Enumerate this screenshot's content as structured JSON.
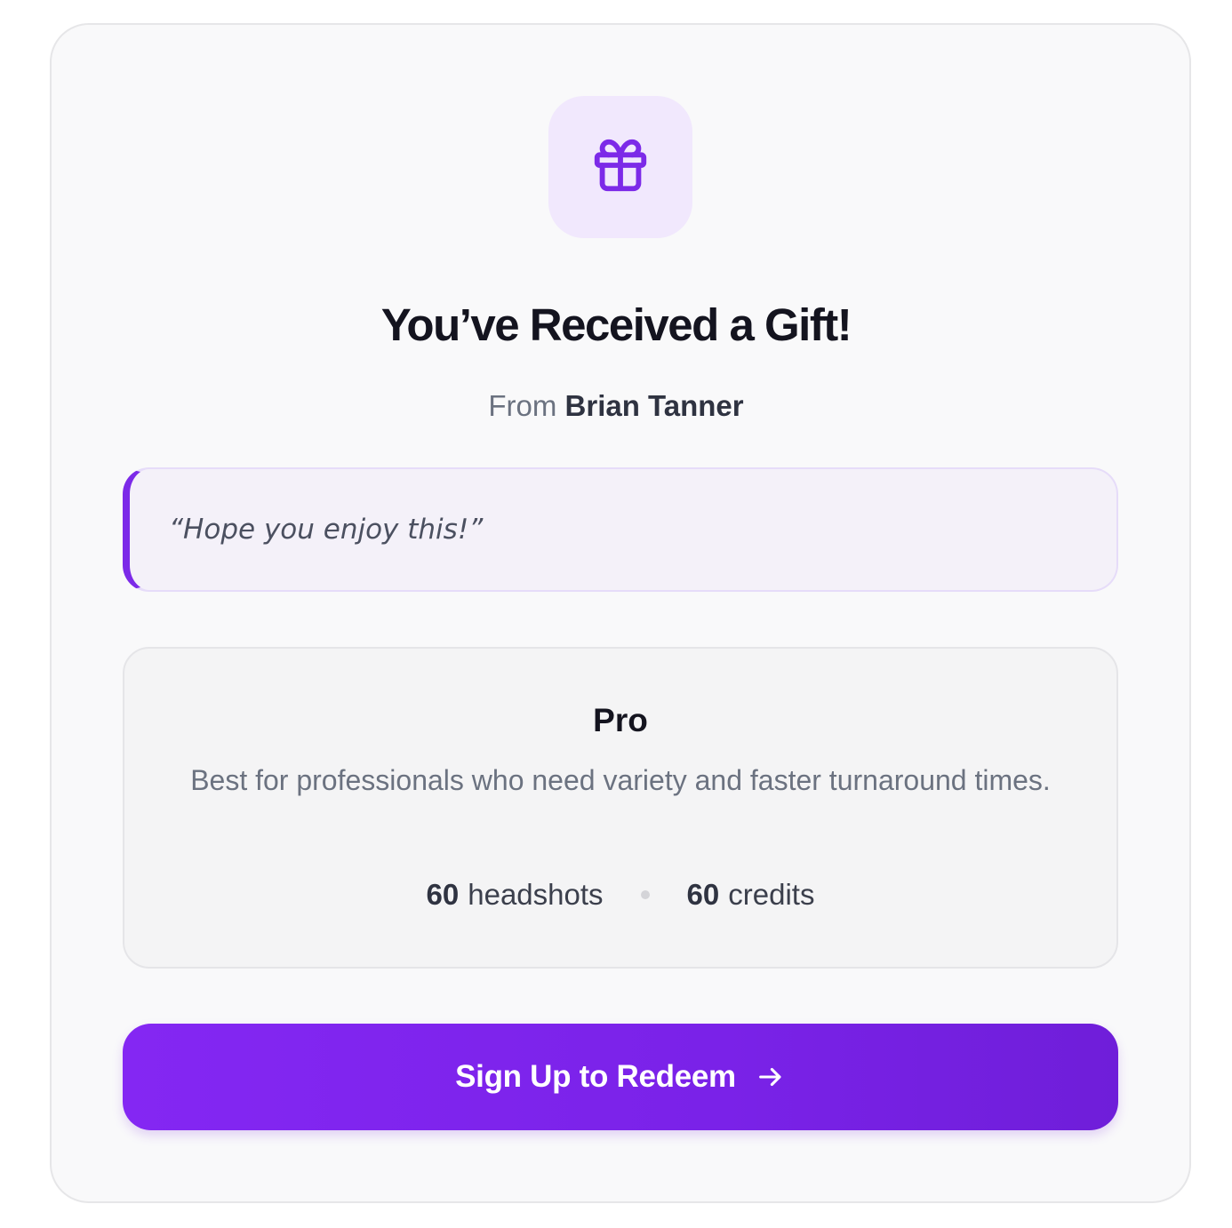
{
  "gift": {
    "icon": "gift-icon",
    "title": "You’ve Received a Gift!",
    "from_prefix": "From",
    "sender_name": "Brian Tanner",
    "message": "“Hope you enjoy this!”"
  },
  "plan": {
    "name": "Pro",
    "description": "Best for professionals who need variety and faster turnaround times.",
    "headshots_count": "60",
    "headshots_label": "headshots",
    "credits_count": "60",
    "credits_label": "credits"
  },
  "cta": {
    "label": "Sign Up to Redeem",
    "icon": "arrow-right-icon"
  },
  "colors": {
    "accent": "#7c2ae8",
    "accent_light": "#f1e8fd",
    "title": "#14141f",
    "muted": "#6b7280"
  }
}
